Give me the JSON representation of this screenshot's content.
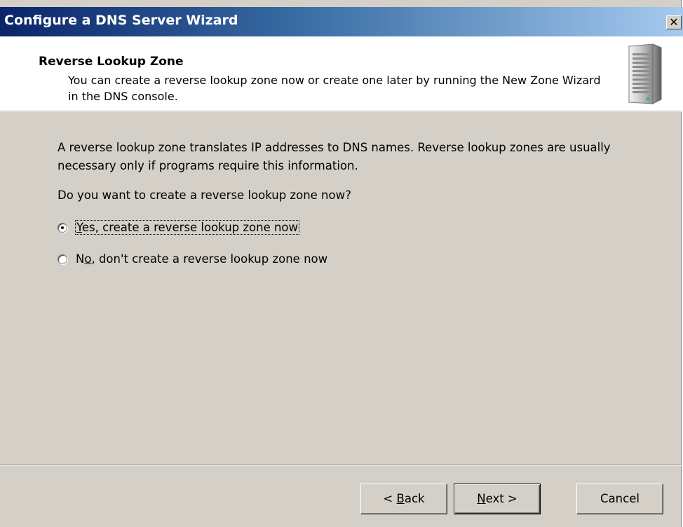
{
  "window": {
    "title": "Configure a DNS Server Wizard",
    "close_glyph": "✕"
  },
  "header": {
    "title": "Reverse Lookup Zone",
    "subtitle": "You can create a reverse lookup zone now or create one later by running the New Zone Wizard in the DNS console."
  },
  "body": {
    "description": "A reverse lookup zone translates IP addresses to DNS names. Reverse lookup zones are usually necessary only if programs require this information.",
    "question": "Do you want to create a reverse lookup zone now?",
    "options": [
      {
        "pre": "",
        "accel": "Y",
        "post": "es, create a reverse lookup zone now",
        "selected": true
      },
      {
        "pre": "N",
        "accel": "o",
        "post": ", don't create a reverse lookup zone now",
        "selected": false
      }
    ]
  },
  "buttons": {
    "back_pre": "< ",
    "back_accel": "B",
    "back_post": "ack",
    "next_accel": "N",
    "next_post": "ext >",
    "cancel": "Cancel"
  },
  "colors": {
    "titlebar_start": "#0a246a",
    "dialog_bg": "#d4d0c8",
    "header_bg": "#ffffff"
  }
}
